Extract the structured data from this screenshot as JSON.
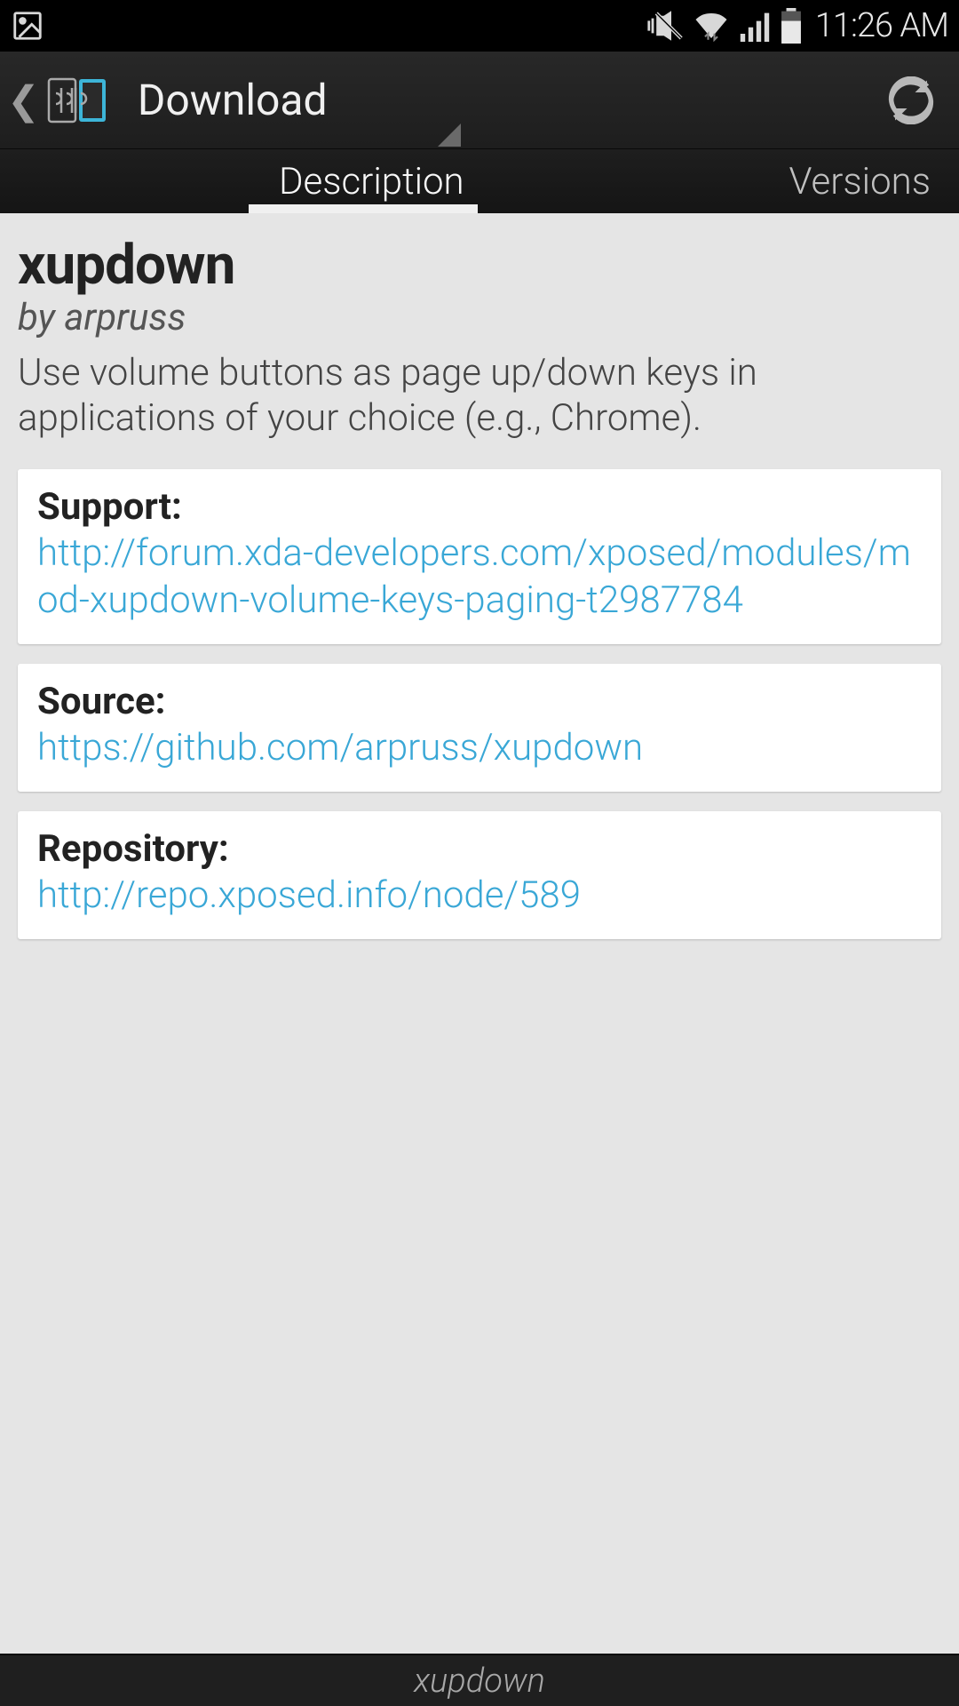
{
  "status_bar": {
    "time": "11:26 AM"
  },
  "action_bar": {
    "title": "Download"
  },
  "tabs": {
    "description": "Description",
    "versions": "Versions"
  },
  "module": {
    "name": "xupdown",
    "author": "by arpruss",
    "description": "Use volume buttons as page up/down keys in applications of your choice (e.g., Chrome)."
  },
  "cards": {
    "support": {
      "label": "Support:",
      "url": "http://forum.xda-developers.com/xposed/modules/mod-xupdown-volume-keys-paging-t2987784"
    },
    "source": {
      "label": "Source:",
      "url": "https://github.com/arpruss/xupdown"
    },
    "repository": {
      "label": "Repository:",
      "url": "http://repo.xposed.info/node/589"
    }
  },
  "bottom_bar": {
    "text": "xupdown"
  }
}
